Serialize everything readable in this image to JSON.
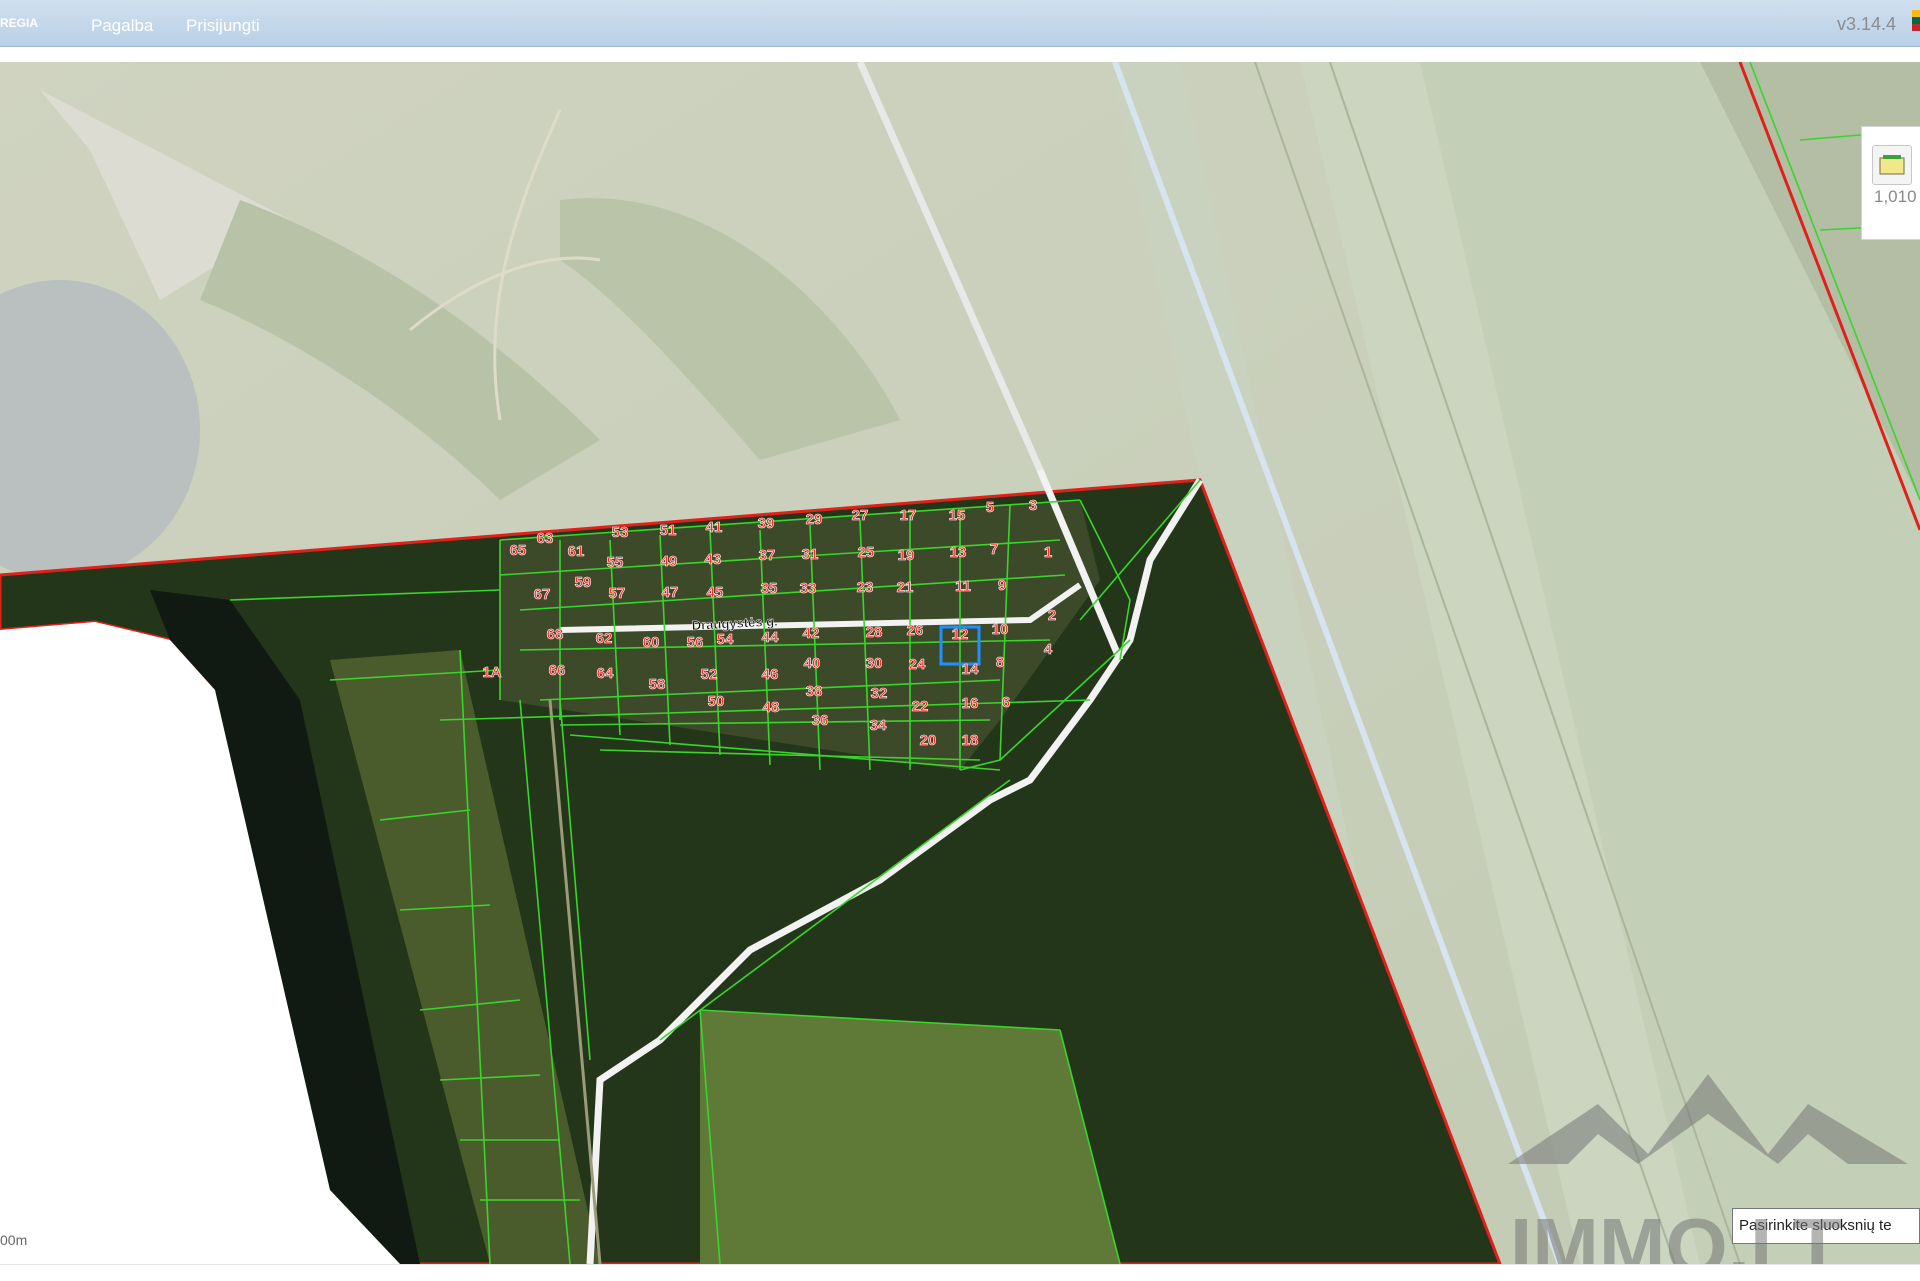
{
  "header": {
    "logo_text": "REGIA",
    "nav": [
      "Pagalba",
      "Prisijungti"
    ],
    "version": "v3.14.4",
    "flag_colors": [
      "#fdb913",
      "#006a44",
      "#c1272d"
    ]
  },
  "map": {
    "street_label": "Draugystės g.",
    "scale_label": "00m",
    "layer_count": "1,010",
    "layer_select_text": "Pasirinkite sluoksnių te",
    "plots": [
      "1",
      "2",
      "3",
      "4",
      "5",
      "6",
      "7",
      "8",
      "9",
      "10",
      "11",
      "12",
      "13",
      "14",
      "15",
      "16",
      "17",
      "18",
      "19",
      "20",
      "21",
      "22",
      "23",
      "24",
      "25",
      "26",
      "27",
      "28",
      "29",
      "30",
      "31",
      "32",
      "33",
      "34",
      "35",
      "36",
      "37",
      "38",
      "39",
      "40",
      "41",
      "42",
      "43",
      "44",
      "45",
      "46",
      "47",
      "48",
      "49",
      "50",
      "51",
      "52",
      "53",
      "54",
      "55",
      "56",
      "57",
      "58",
      "59",
      "60",
      "61",
      "62",
      "63",
      "64",
      "65",
      "66",
      "67",
      "68",
      "1A"
    ],
    "selected_plot": "12",
    "colors": {
      "boundary": "#e0201b",
      "parcel": "#39d52a",
      "selected": "#1e90ff",
      "label": "#ff2a2a"
    }
  },
  "watermark": {
    "text": "IMMO.LT"
  }
}
